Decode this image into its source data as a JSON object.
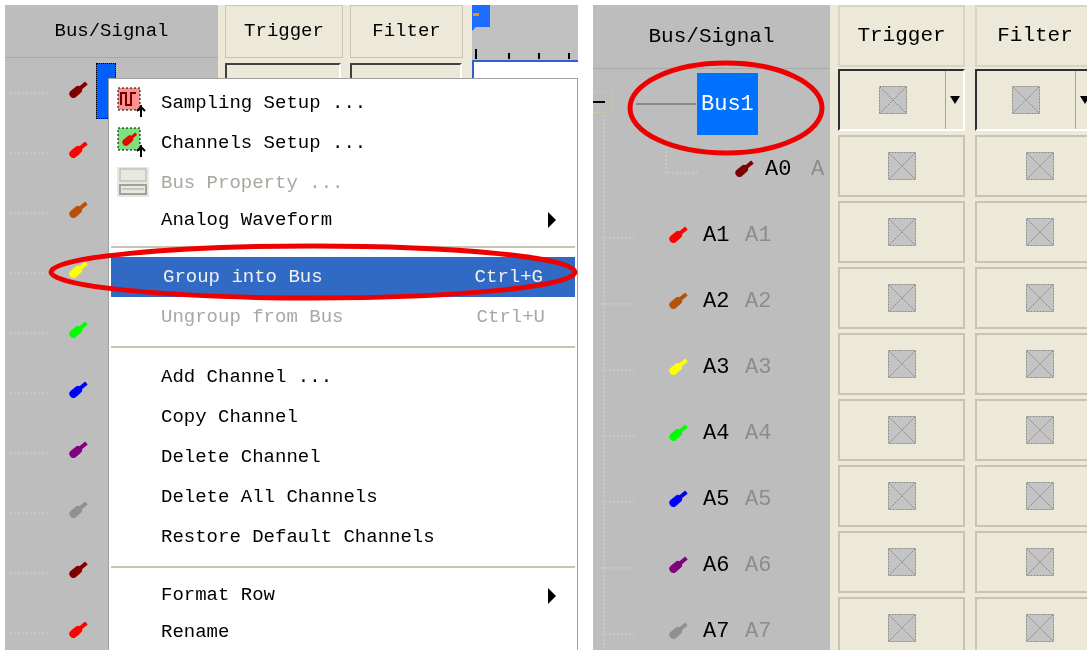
{
  "left_panel": {
    "columns": [
      {
        "label": "Bus/Signal"
      },
      {
        "label": "Trigger"
      },
      {
        "label": "Filter"
      }
    ],
    "signals": [
      {
        "color": "#800000",
        "selected": true
      },
      {
        "color": "#ff0000",
        "selected": false
      },
      {
        "color": "#b8520a",
        "selected": false
      },
      {
        "color": "#ffff00",
        "selected": false
      },
      {
        "color": "#00ff00",
        "selected": false
      },
      {
        "color": "#0000ff",
        "selected": false
      },
      {
        "color": "#800080",
        "selected": false
      },
      {
        "color": "#909090",
        "selected": false
      },
      {
        "color": "#800000",
        "selected": false
      },
      {
        "color": "#ff0000",
        "selected": false
      }
    ],
    "context_menu": [
      {
        "kind": "sampling",
        "label": "Sampling Setup ...",
        "disabled": false,
        "selected": false
      },
      {
        "kind": "channels",
        "label": "Channels Setup ...",
        "disabled": false,
        "selected": false
      },
      {
        "kind": "bus",
        "label": "Bus Property ...",
        "disabled": true,
        "selected": false
      },
      {
        "kind": "submenu",
        "label": "Analog Waveform",
        "disabled": false,
        "selected": false
      },
      {
        "kind": "separator"
      },
      {
        "kind": "plain",
        "label": "Group into Bus",
        "shortcut": "Ctrl+G",
        "disabled": false,
        "selected": true
      },
      {
        "kind": "plain",
        "label": "Ungroup from Bus",
        "shortcut": "Ctrl+U",
        "disabled": true,
        "selected": false
      },
      {
        "kind": "separator"
      },
      {
        "kind": "plain",
        "label": "Add Channel ...",
        "disabled": false,
        "selected": false
      },
      {
        "kind": "plain",
        "label": "Copy Channel",
        "disabled": false,
        "selected": false
      },
      {
        "kind": "plain",
        "label": "Delete Channel",
        "disabled": false,
        "selected": false
      },
      {
        "kind": "plain",
        "label": "Delete All Channels",
        "disabled": false,
        "selected": false
      },
      {
        "kind": "plain",
        "label": "Restore Default Channels",
        "disabled": false,
        "selected": false
      },
      {
        "kind": "separator"
      },
      {
        "kind": "submenu",
        "label": "Format Row",
        "disabled": false,
        "selected": false
      },
      {
        "kind": "plain",
        "label": "Rename",
        "disabled": false,
        "selected": false
      }
    ]
  },
  "right_panel": {
    "columns": [
      {
        "label": "Bus/Signal"
      },
      {
        "label": "Trigger"
      },
      {
        "label": "Filter"
      }
    ],
    "bus": {
      "name": "Bus1",
      "selected": true,
      "expanded": true,
      "children": [
        {
          "name": "A0",
          "alias": "A",
          "color": "#800000"
        }
      ]
    },
    "signals": [
      {
        "name": "A1",
        "alias": "A1",
        "color": "#ff0000"
      },
      {
        "name": "A2",
        "alias": "A2",
        "color": "#b8520a"
      },
      {
        "name": "A3",
        "alias": "A3",
        "color": "#ffff00"
      },
      {
        "name": "A4",
        "alias": "A4",
        "color": "#00ff00"
      },
      {
        "name": "A5",
        "alias": "A5",
        "color": "#0000ff"
      },
      {
        "name": "A6",
        "alias": "A6",
        "color": "#800080"
      },
      {
        "name": "A7",
        "alias": "A7",
        "color": "#909090"
      }
    ]
  }
}
